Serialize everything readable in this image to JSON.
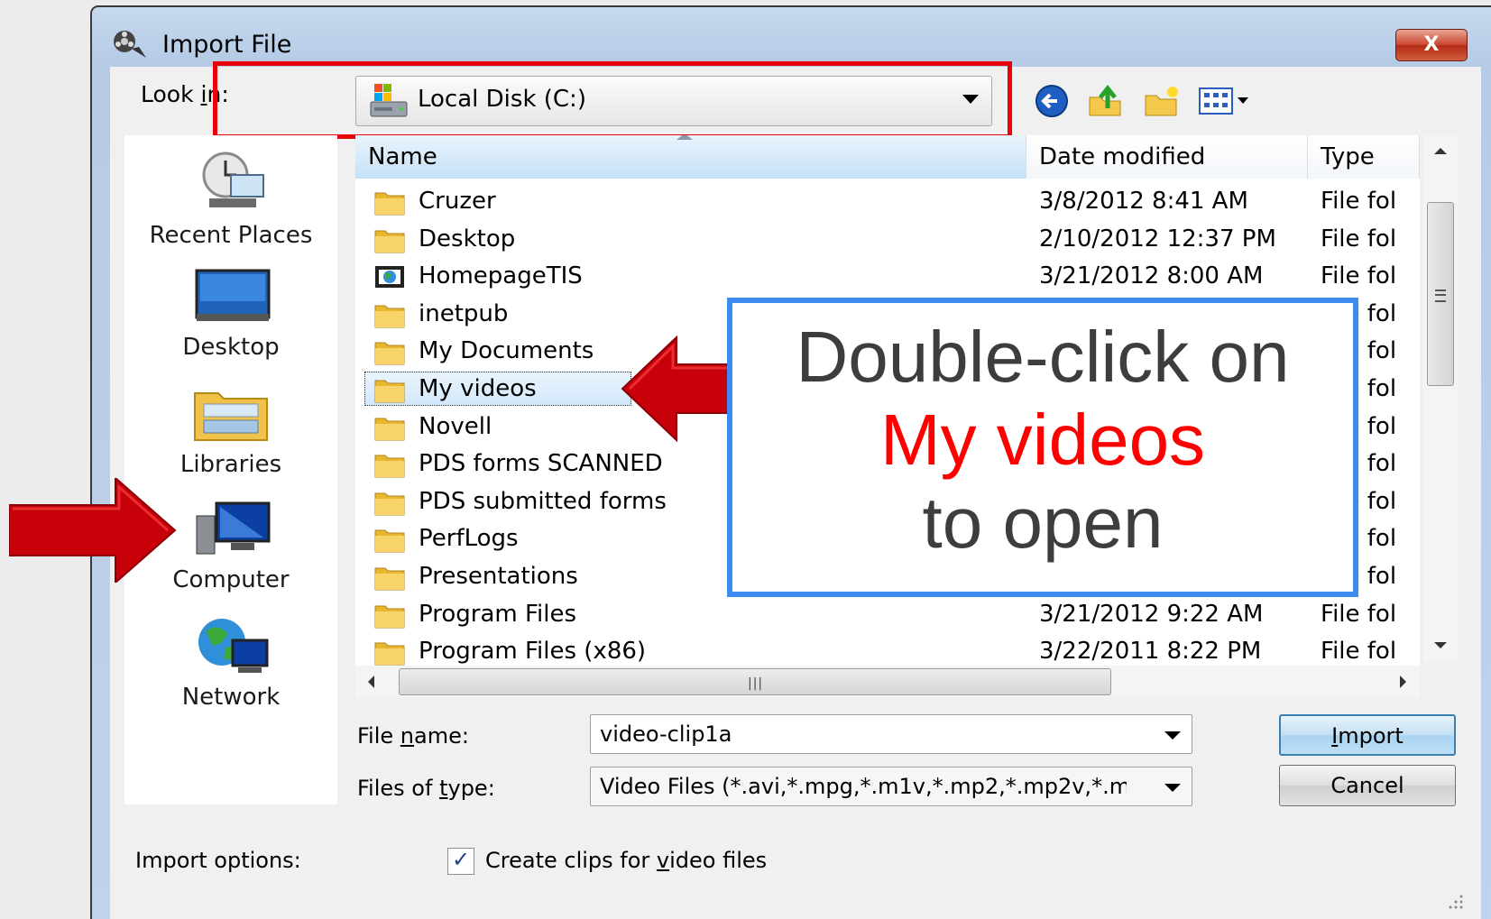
{
  "window": {
    "title": "Import File",
    "close_label": "X"
  },
  "look_in": {
    "label_before": "Look ",
    "label_hotkey": "i",
    "label_after": "n:",
    "value": "Local Disk (C:)"
  },
  "toolbar": {
    "icons": [
      "back-icon",
      "up-folder-icon",
      "new-folder-icon",
      "view-menu-icon"
    ]
  },
  "places": [
    {
      "label": "Recent Places",
      "icon": "recent-places-icon"
    },
    {
      "label": "Desktop",
      "icon": "desktop-icon"
    },
    {
      "label": "Libraries",
      "icon": "libraries-icon"
    },
    {
      "label": "Computer",
      "icon": "computer-icon"
    },
    {
      "label": "Network",
      "icon": "network-icon"
    }
  ],
  "columns": {
    "name": "Name",
    "date": "Date modified",
    "type": "Type"
  },
  "files": [
    {
      "name": "Cruzer",
      "date": "3/8/2012 8:41 AM",
      "type": "File fol"
    },
    {
      "name": "Desktop",
      "date": "2/10/2012 12:37 PM",
      "type": "File fol"
    },
    {
      "name": "HomepageTIS",
      "date": "3/21/2012 8:00 AM",
      "type": "File fol"
    },
    {
      "name": "inetpub",
      "date": "",
      "type": "File fol"
    },
    {
      "name": "My Documents",
      "date": "",
      "type": "File fol"
    },
    {
      "name": "My videos",
      "date": "",
      "type": "File fol"
    },
    {
      "name": "Novell",
      "date": "",
      "type": "File fol"
    },
    {
      "name": "PDS forms SCANNED",
      "date": "",
      "type": "File fol"
    },
    {
      "name": "PDS submitted forms",
      "date": "",
      "type": "File fol"
    },
    {
      "name": "PerfLogs",
      "date": "",
      "type": "File fol"
    },
    {
      "name": "Presentations",
      "date": "",
      "type": "File fol"
    },
    {
      "name": "Program Files",
      "date": "3/21/2012 9:22 AM",
      "type": "File fol"
    },
    {
      "name": "Program Files (x86)",
      "date": "3/22/2011 8:22 PM",
      "type": "File fol"
    }
  ],
  "file_name": {
    "label_before": "File ",
    "label_hotkey": "n",
    "label_after": "ame:",
    "value": "video-clip1a"
  },
  "file_type": {
    "label_before": "Files of ",
    "label_hotkey": "t",
    "label_after": "ype:",
    "value": "Video Files (*.avi,*.mpg,*.m1v,*.mp2,*.mp2v,*.m"
  },
  "buttons": {
    "import_hotkey": "I",
    "import_rest": "mport",
    "cancel": "Cancel"
  },
  "import_options": {
    "label": "Import options:",
    "checkbox_before": "Create clips for ",
    "checkbox_hotkey": "v",
    "checkbox_after": "ideo files",
    "checked": true
  },
  "callout": {
    "line1": "Double-click on",
    "line2": "My videos",
    "line3": "to open"
  },
  "colors": {
    "highlight_red": "#e8000b",
    "callout_border": "#3b8bf0",
    "callout_accent": "#ff0000",
    "arrow_red": "#c8000a"
  }
}
